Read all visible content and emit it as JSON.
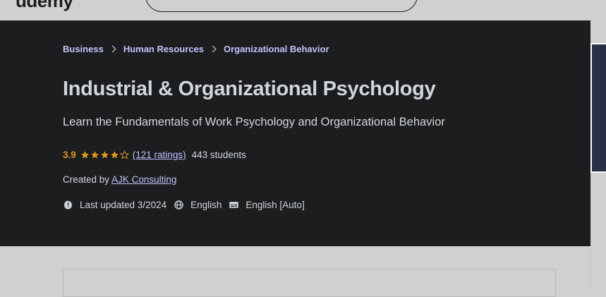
{
  "header": {
    "logo": "udemy"
  },
  "breadcrumb": [
    {
      "label": "Business"
    },
    {
      "label": "Human Resources"
    },
    {
      "label": "Organizational Behavior"
    }
  ],
  "course": {
    "title": "Industrial & Organizational Psychology",
    "subtitle": "Learn the Fundamentals of Work Psychology and Organizational Behavior",
    "rating": "3.9",
    "rating_value": 3.9,
    "ratings_count": "(121 ratings)",
    "students": "443 students",
    "created_by_label": "Created by",
    "creator": "AJK Consulting",
    "last_updated": "Last updated 3/2024",
    "language": "English",
    "captions": "English [Auto]"
  },
  "colors": {
    "hero_bg": "#1c1d1f",
    "link": "#c0c4fc",
    "rating": "#e59819",
    "text": "#d1d7dc"
  },
  "icons": {
    "updated": "alert-badge-icon",
    "language": "globe-icon",
    "captions": "closed-captions-icon"
  }
}
